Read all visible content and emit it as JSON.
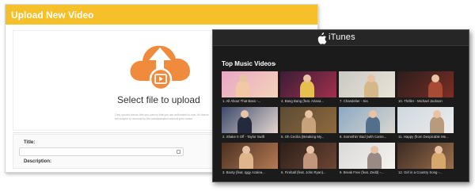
{
  "upload": {
    "header_title": "Upload New Video",
    "select_label": "Select file to upload",
    "fine_print": "Only upload videos that you own or that you are authorized to use. All videos are subject to removal by the administration without prior notice.",
    "title_label": "Title:",
    "description_label": "Description:",
    "accent_color": "#f5c02a",
    "icon_color": "#f08a3c"
  },
  "itunes": {
    "app_name": "iTunes",
    "section_title": "Top Music Videos",
    "section_chevron": "›",
    "videos": [
      {
        "caption": "1. All About That Bass -...",
        "colors": [
          "#e9a7c6",
          "#f4d3b8",
          "#f2c9a4"
        ]
      },
      {
        "caption": "4. Bang Bang (feat. Ariana...",
        "colors": [
          "#3b1c36",
          "#a0304c",
          "#e6c04f"
        ]
      },
      {
        "caption": "7. Chandelier - Sia",
        "colors": [
          "#c9c9c4",
          "#e9e3d6",
          "#d4b889"
        ]
      },
      {
        "caption": "10. Thriller - Michael Jackson",
        "colors": [
          "#2a1e1c",
          "#7c2d25",
          "#a84a34"
        ]
      },
      {
        "caption": "2. Shake It Off - Taylor Swift",
        "colors": [
          "#3c4a6a",
          "#e5d6d0",
          "#232a3e"
        ]
      },
      {
        "caption": "5. Oh Cecilia (Breaking My...",
        "colors": [
          "#5c4b35",
          "#8e6a3d",
          "#c7a27a"
        ]
      },
      {
        "caption": "8. Somethin' Bad (with Carrie...",
        "colors": [
          "#8ca8c4",
          "#d9d7cf",
          "#546f8c"
        ]
      },
      {
        "caption": "11. Happy (from Despicable Me...",
        "colors": [
          "#cfd8df",
          "#ececec",
          "#b89a7c"
        ]
      },
      {
        "caption": "3. Booty (feat. Iggy Azalea...",
        "colors": [
          "#4a3021",
          "#b57a54",
          "#e0b58b"
        ]
      },
      {
        "caption": "6. Fireball (feat. John Ryan)...",
        "colors": [
          "#2d1f1a",
          "#6d4534",
          "#c2967a"
        ]
      },
      {
        "caption": "9. Break Free (feat. Zedd) -...",
        "colors": [
          "#d9d9d9",
          "#f5f2ee",
          "#9a8a84"
        ]
      },
      {
        "caption": "12. Girl in a Country Song -...",
        "colors": [
          "#3b2a22",
          "#9b6f4d",
          "#d7a86b"
        ]
      }
    ]
  }
}
